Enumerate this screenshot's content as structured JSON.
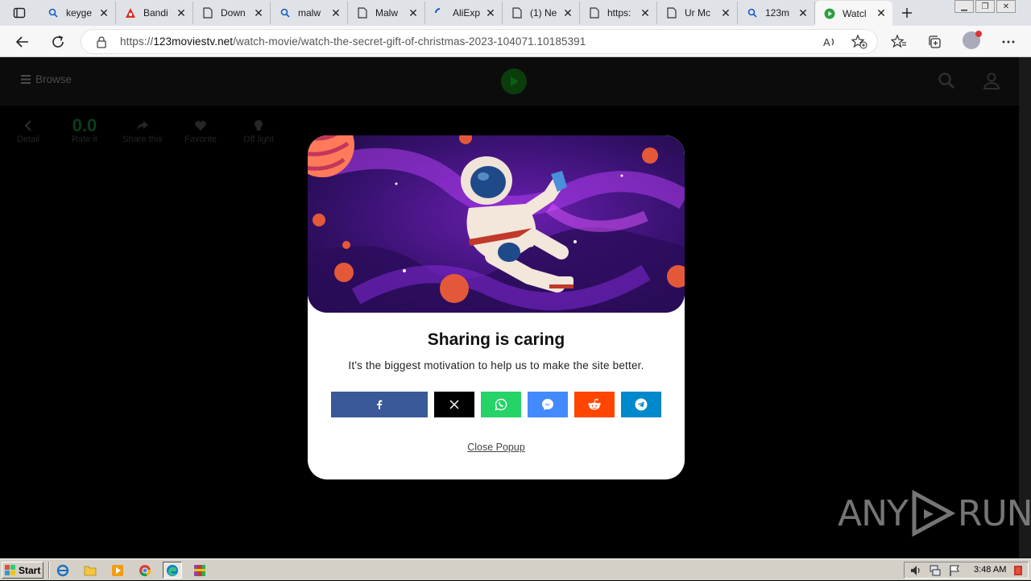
{
  "browser": {
    "tabs": [
      {
        "label": "keyge",
        "icon": "search-icon"
      },
      {
        "label": "Bandi",
        "icon": "bandicam-icon"
      },
      {
        "label": "Down",
        "icon": "page-icon"
      },
      {
        "label": "malw",
        "icon": "search-icon"
      },
      {
        "label": "Malw",
        "icon": "page-icon"
      },
      {
        "label": "AliExp",
        "icon": "loading-icon"
      },
      {
        "label": "(1) Ne",
        "icon": "page-icon"
      },
      {
        "label": "https:",
        "icon": "page-icon"
      },
      {
        "label": "Ur Mc",
        "icon": "page-icon"
      },
      {
        "label": "123m",
        "icon": "search-icon"
      },
      {
        "label": "Watcl",
        "icon": "play-icon",
        "active": true
      }
    ],
    "url_prefix": "https://",
    "url_host": "123moviestv.net",
    "url_path": "/watch-movie/watch-the-secret-gift-of-christmas-2023-104071.10185391"
  },
  "site": {
    "browse_label": "Browse",
    "actions": [
      {
        "label": "Detail",
        "icon": "chevron-left-icon"
      },
      {
        "label": "Rate it",
        "value": "0.0"
      },
      {
        "label": "Share this",
        "icon": "share-icon"
      },
      {
        "label": "Favorite",
        "icon": "heart-icon"
      },
      {
        "label": "Off light",
        "icon": "bulb-icon"
      }
    ]
  },
  "popup": {
    "title": "Sharing is caring",
    "subtitle": "It's the biggest motivation to help us to make the site better.",
    "share_buttons": [
      {
        "name": "facebook",
        "color": "#3b5998",
        "icon": "facebook-icon"
      },
      {
        "name": "x",
        "color": "#000000",
        "icon": "x-icon"
      },
      {
        "name": "whatsapp",
        "color": "#25d366",
        "icon": "whatsapp-icon"
      },
      {
        "name": "messenger",
        "color": "#448aff",
        "icon": "messenger-icon"
      },
      {
        "name": "reddit",
        "color": "#ff4500",
        "icon": "reddit-icon"
      },
      {
        "name": "telegram",
        "color": "#0088cc",
        "icon": "telegram-icon"
      }
    ],
    "close_label": "Close Popup"
  },
  "watermark": {
    "left": "ANY",
    "right": "RUN"
  },
  "taskbar": {
    "start_label": "Start",
    "clock": "3:48 AM"
  }
}
